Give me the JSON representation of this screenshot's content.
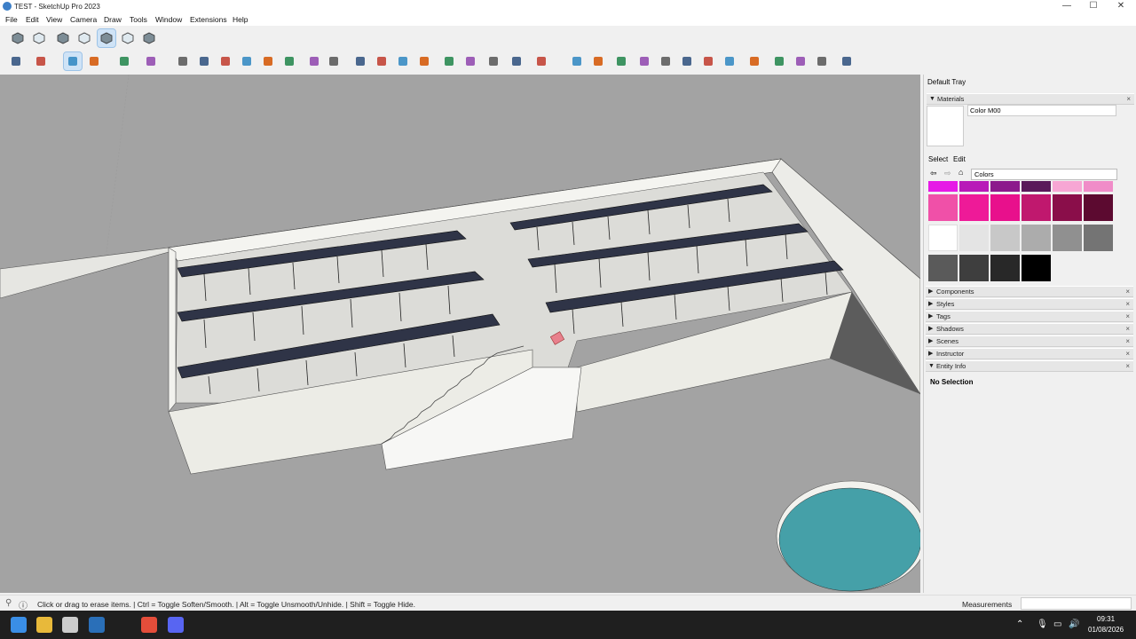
{
  "window": {
    "title": "TEST - SketchUp Pro 2023",
    "controls": {
      "minimize": "—",
      "maximize": "☐",
      "close": "✕"
    }
  },
  "menu": [
    "File",
    "Edit",
    "View",
    "Camera",
    "Draw",
    "Tools",
    "Window",
    "Extensions",
    "Help"
  ],
  "toolbar_row1": [
    {
      "icon": "iso-view-icon"
    },
    {
      "icon": "top-view-icon"
    },
    {
      "icon": "xray-style-icon"
    },
    {
      "icon": "wireframe-style-icon"
    },
    {
      "icon": "shaded-style-icon",
      "selected": true
    },
    {
      "icon": "shaded-texture-style-icon"
    },
    {
      "icon": "monochrome-style-icon"
    }
  ],
  "toolbar_row2": [
    {
      "icon": "search-icon"
    },
    {
      "icon": "select-arrow-icon"
    },
    {
      "icon": "eraser-icon",
      "selected": true
    },
    {
      "icon": "pencil-line-icon"
    },
    {
      "icon": "freehand-icon"
    },
    {
      "icon": "paint-bucket-icon"
    },
    {
      "icon": "push-pull-icon"
    },
    {
      "icon": "offset-icon"
    },
    {
      "icon": "move-icon"
    },
    {
      "icon": "rotate-icon"
    },
    {
      "icon": "scale-icon"
    },
    {
      "icon": "follow-me-icon"
    },
    {
      "icon": "tape-measure-icon"
    },
    {
      "icon": "text-label-icon"
    },
    {
      "icon": "orbit-icon"
    },
    {
      "icon": "pan-hand-icon"
    },
    {
      "icon": "zoom-icon"
    },
    {
      "icon": "zoom-extents-icon"
    },
    {
      "icon": "section-plane-icon"
    },
    {
      "icon": "section-display-icon"
    },
    {
      "icon": "layers-icon"
    },
    {
      "icon": "solid-tools-icon"
    },
    {
      "icon": "account-icon"
    },
    {
      "icon": "3d-warehouse-icon"
    },
    {
      "icon": "components-window-icon"
    },
    {
      "icon": "extension-warehouse-icon"
    },
    {
      "icon": "add-location-icon"
    },
    {
      "icon": "geo-icon"
    },
    {
      "icon": "import-icon"
    },
    {
      "icon": "texture-grid-icon"
    },
    {
      "icon": "cloud-icon"
    },
    {
      "icon": "settings-gear-icon"
    },
    {
      "icon": "layout-send-icon"
    },
    {
      "icon": "info-icon"
    },
    {
      "icon": "cart-icon"
    },
    {
      "icon": "user-profile-icon"
    }
  ],
  "tray": {
    "title": "Default Tray",
    "materials": {
      "header": "Materials",
      "name_value": "Color M00",
      "tabs": [
        "Select",
        "Edit"
      ],
      "library": "Colors",
      "swatches": [
        "#e61ae6",
        "#b81ab8",
        "#8c1a8c",
        "#5a1a5a",
        "#f7a6d4",
        "#f08cc8",
        "#f050a8",
        "#ee1a98",
        "#e8108c",
        "#c0186e",
        "#8a0e4a",
        "#5c0a30",
        "#ffffff",
        "#e4e4e4",
        "#c8c8c8",
        "#acacac",
        "#909090",
        "#747474",
        "#5a5a5a",
        "#3e3e3e",
        "#282828",
        "#000000"
      ]
    },
    "panels": [
      "Components",
      "Styles",
      "Tags",
      "Shadows",
      "Scenes",
      "Instructor",
      "Entity Info"
    ],
    "entity_info_text": "No Selection"
  },
  "status": {
    "hint": "Click or drag to erase items. | Ctrl = Toggle Soften/Smooth. | Alt = Toggle Unsmooth/Unhide. | Shift = Toggle Hide.",
    "measurements_label": "Measurements"
  },
  "taskbar": {
    "time": "09:31",
    "date": "01/08/2026",
    "apps": [
      "windows-start-icon",
      "file-explorer-icon",
      "app-icon-2",
      "sketchup-taskbar-icon",
      "chrome-icon",
      "discord-icon"
    ]
  },
  "colors": {
    "viewport_ground": "#a3a3a3",
    "wall": "#eeeeea",
    "panel": "#2f3447",
    "water": "#45a0a8"
  }
}
